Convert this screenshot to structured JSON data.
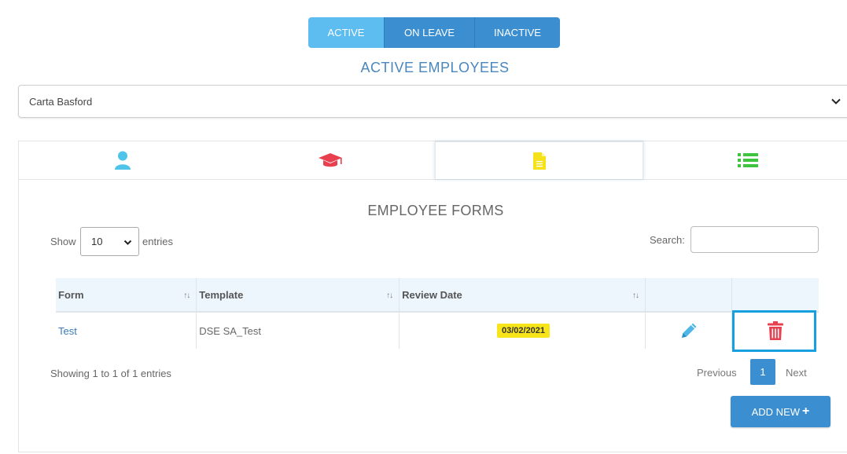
{
  "status_tabs": [
    {
      "label": "ACTIVE",
      "selected": true
    },
    {
      "label": "ON LEAVE",
      "selected": false
    },
    {
      "label": "INACTIVE",
      "selected": false
    }
  ],
  "page_title": "ACTIVE EMPLOYEES",
  "employee_select": {
    "value": "Carta Basford"
  },
  "section_tabs": [
    {
      "icon": "user-icon",
      "color": "#4fc3e8"
    },
    {
      "icon": "graduation-cap-icon",
      "color": "#e8404f"
    },
    {
      "icon": "document-icon",
      "color": "#f5e21b",
      "selected": true
    },
    {
      "icon": "list-icon",
      "color": "#3ec43e"
    }
  ],
  "forms_heading": "EMPLOYEE FORMS",
  "length_control": {
    "show": "Show",
    "value": "10",
    "entries": "entries"
  },
  "search": {
    "label": "Search:",
    "value": ""
  },
  "table": {
    "columns": [
      "Form",
      "Template",
      "Review Date"
    ],
    "rows": [
      {
        "form": "Test",
        "template": "DSE SA_Test",
        "review_date": "03/02/2021"
      }
    ]
  },
  "info": "Showing 1 to 1 of 1 entries",
  "pagination": {
    "previous": "Previous",
    "current": "1",
    "next": "Next"
  },
  "add_button": {
    "label": "ADD NEW",
    "icon": "plus-icon"
  },
  "colors": {
    "primary": "#3b8fd0",
    "active_tab": "#5dbcf0",
    "title": "#4a87bd",
    "delete": "#e8404f",
    "edit": "#4fb6e8",
    "highlight": "#16a0e0"
  }
}
